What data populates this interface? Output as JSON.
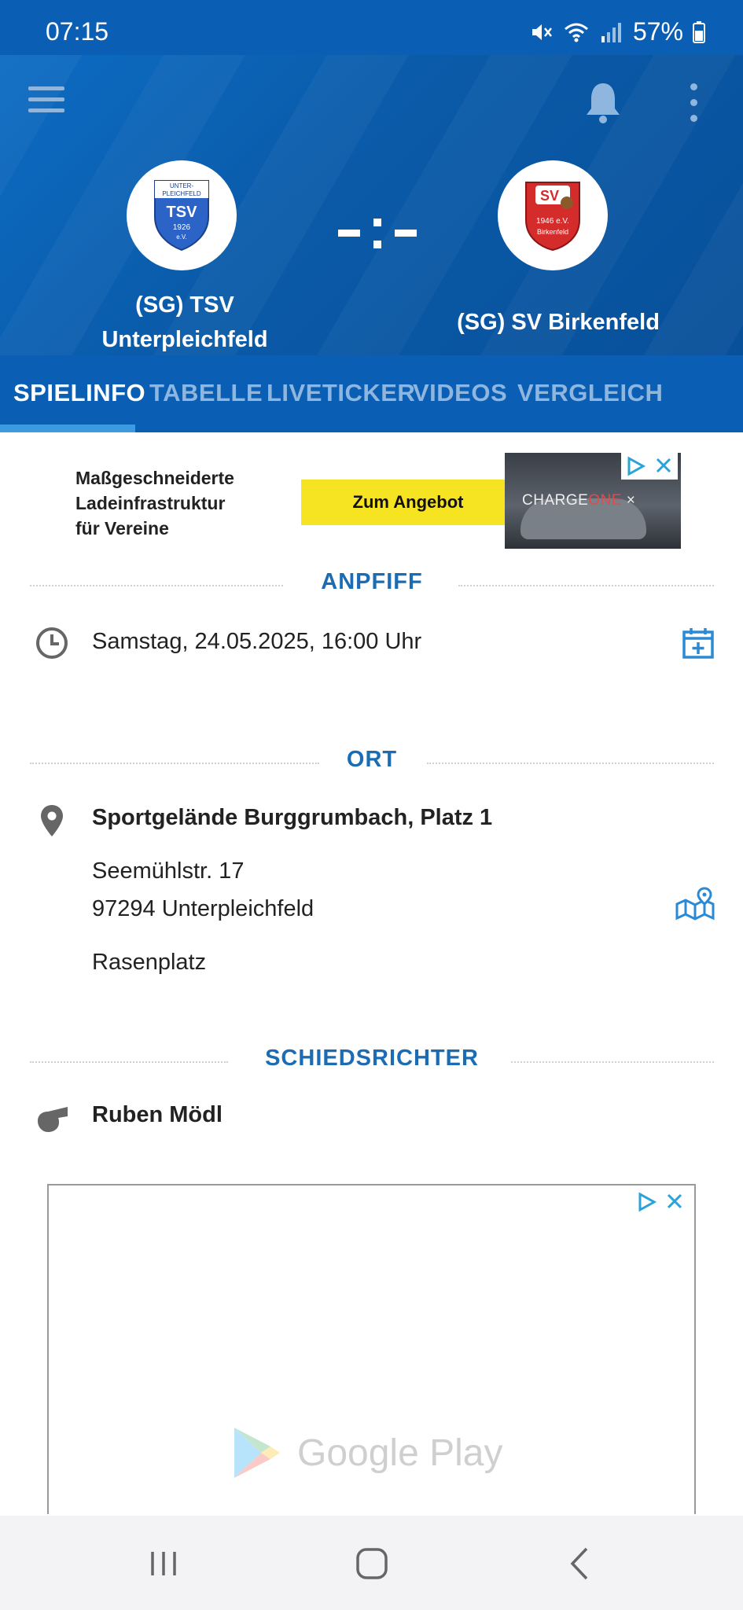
{
  "status_bar": {
    "time": "07:15",
    "battery": "57%",
    "icons": [
      "mute-icon",
      "wifi-icon",
      "signal-icon",
      "battery-icon"
    ]
  },
  "header": {
    "menu_icon": "hamburger-menu-icon",
    "bell_icon": "bell-icon",
    "more_icon": "more-vertical-icon",
    "score": "-:-",
    "home_team": {
      "name_line1": "(SG) TSV",
      "name_line2": "Unterpleichfeld",
      "logo_text": {
        "top": "UNTER-",
        "top2": "PLEICHFELD",
        "main": "TSV",
        "year": "1926",
        "suffix": "e.V."
      }
    },
    "away_team": {
      "name": "(SG) SV Birkenfeld",
      "logo_text": {
        "main": "SV",
        "year": "1946 e.V.",
        "place": "Birkenfeld"
      }
    }
  },
  "tabs": [
    {
      "label": "SPIELINFO",
      "active": true
    },
    {
      "label": "TABELLE",
      "active": false
    },
    {
      "label": "LIVETICKER",
      "active": false
    },
    {
      "label": "VIDEOS",
      "active": false
    },
    {
      "label": "VERGLEICH",
      "active": false
    }
  ],
  "ad_banner": {
    "line1": "Maßgeschneiderte",
    "line2": "Ladeinfrastruktur",
    "line3": "für Vereine",
    "cta": "Zum Angebot",
    "brand_a": "CHARGE",
    "brand_b": "ONE",
    "brand_x": "×",
    "cta_color": "#f6e321"
  },
  "anpfiff": {
    "heading": "ANPFIFF",
    "datetime": "Samstag, 24.05.2025, 16:00 Uhr",
    "icon": "clock-icon",
    "action_icon": "calendar-add-icon"
  },
  "ort": {
    "heading": "ORT",
    "venue": "Sportgelände Burggrumbach, Platz 1",
    "street": "Seemühlstr. 17",
    "city": "97294 Unterpleichfeld",
    "surface": "Rasenplatz",
    "icon": "location-pin-icon",
    "action_icon": "map-icon"
  },
  "schiedsrichter": {
    "heading": "SCHIEDSRICHTER",
    "name": "Ruben Mödl",
    "icon": "whistle-icon"
  },
  "ad_box": {
    "store_label": "Google Play"
  },
  "nav_bar": {
    "recent": "recent-apps-icon",
    "home": "home-icon",
    "back": "back-icon"
  },
  "colors": {
    "primary": "#0a5fb4",
    "accent": "#1c6cb4",
    "tab_inactive": "#8fb6de",
    "indicator": "#3c9be0"
  }
}
